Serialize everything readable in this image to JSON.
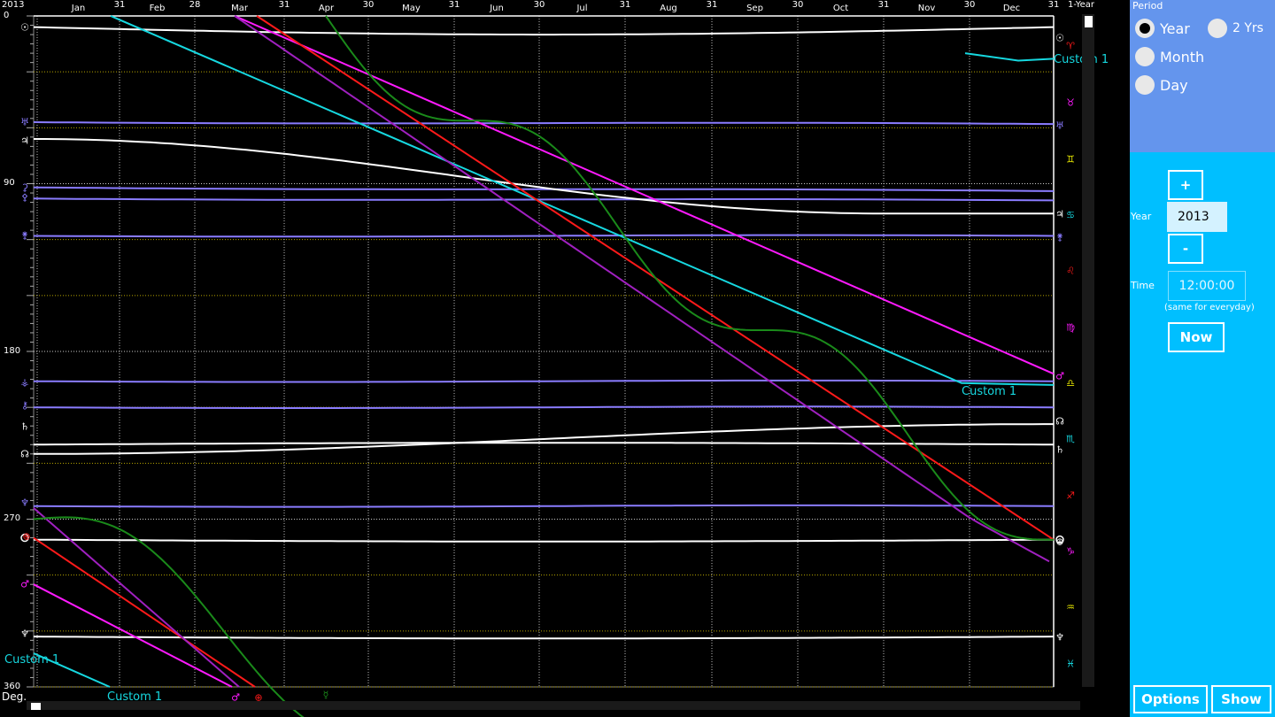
{
  "chart": {
    "year_label": "2013",
    "mode_label": "1-Year",
    "axis_title": "Deg.",
    "months": [
      "Jan",
      "Feb",
      "Mar",
      "Apr",
      "May",
      "Jun",
      "Jul",
      "Aug",
      "Sep",
      "Oct",
      "Nov",
      "Dec"
    ],
    "month_end_days": [
      "31",
      "28",
      "31",
      "30",
      "31",
      "30",
      "31",
      "31",
      "30",
      "31",
      "30",
      "31"
    ],
    "degree_labels": [
      "0",
      "90",
      "180",
      "270",
      "360"
    ],
    "curve_labels": [
      "Custom  1",
      "Custom  1",
      "Custom  1",
      "Custom  1"
    ],
    "zero_marker": "0"
  },
  "chart_data": {
    "type": "line",
    "xlabel": "",
    "ylabel": "Deg.",
    "ylim": [
      0,
      360
    ],
    "x_months": [
      "Jan",
      "Feb",
      "Mar",
      "Apr",
      "May",
      "Jun",
      "Jul",
      "Aug",
      "Sep",
      "Oct",
      "Nov",
      "Dec"
    ],
    "series": [
      {
        "name": "Custom  1",
        "color": "#16d8e0",
        "start_deg": 0,
        "end_deg": 198
      },
      {
        "name": "",
        "color": "#ff1a1a",
        "start_deg": 280,
        "end_deg": 281
      },
      {
        "name": "",
        "color": "#ff1aff",
        "start_deg": 305,
        "end_deg": 192
      },
      {
        "name": "",
        "color": "#1a8a1a",
        "start_deg": 270,
        "end_deg": 281
      },
      {
        "name": "",
        "color": "#a020c0",
        "start_deg": 264,
        "end_deg": 298
      },
      {
        "name": "",
        "color": "#ffffff",
        "start_deg": 6,
        "end_deg": 10
      },
      {
        "name": "",
        "color": "#ffffff",
        "start_deg": 66,
        "end_deg": 106
      },
      {
        "name": "",
        "color": "#ffffff",
        "start_deg": 230,
        "end_deg": 229
      },
      {
        "name": "",
        "color": "#ffffff",
        "start_deg": 235,
        "end_deg": 219
      },
      {
        "name": "",
        "color": "#ffffff",
        "start_deg": 281,
        "end_deg": 281
      },
      {
        "name": "",
        "color": "#ffffff",
        "start_deg": 333,
        "end_deg": 334
      },
      {
        "name": "",
        "color": "#8a7cff",
        "start_deg": 57,
        "end_deg": 58
      },
      {
        "name": "",
        "color": "#8a7cff",
        "start_deg": 92,
        "end_deg": 94
      },
      {
        "name": "",
        "color": "#8a7cff",
        "start_deg": 98,
        "end_deg": 99
      },
      {
        "name": "",
        "color": "#8a7cff",
        "start_deg": 118,
        "end_deg": 118
      },
      {
        "name": "",
        "color": "#8a7cff",
        "start_deg": 196,
        "end_deg": 196
      },
      {
        "name": "",
        "color": "#8a7cff",
        "start_deg": 210,
        "end_deg": 210
      },
      {
        "name": "",
        "color": "#8a7cff",
        "start_deg": 263,
        "end_deg": 263
      }
    ],
    "grid": true,
    "curve_colors": {
      "cyan": "#16d8e0",
      "red": "#ff1a1a",
      "magenta": "#ff1aff",
      "green": "#1a8a1a",
      "purple": "#a020c0",
      "white": "#ffffff",
      "lavender": "#8a7cff"
    }
  },
  "side": {
    "period_title": "Period",
    "period_options": [
      {
        "label": "Year",
        "selected": true
      },
      {
        "label": "2 Yrs",
        "selected": false
      },
      {
        "label": "Month",
        "selected": false
      },
      {
        "label": "Day",
        "selected": false
      }
    ],
    "plus_label": "+",
    "minus_label": "-",
    "year_field_label": "Year",
    "year_value": "2013",
    "time_field_label": "Time",
    "time_placeholder": "12:00:00",
    "time_note": "(same for everyday)",
    "now_label": "Now",
    "options_label": "Options",
    "show_label": "Show"
  }
}
